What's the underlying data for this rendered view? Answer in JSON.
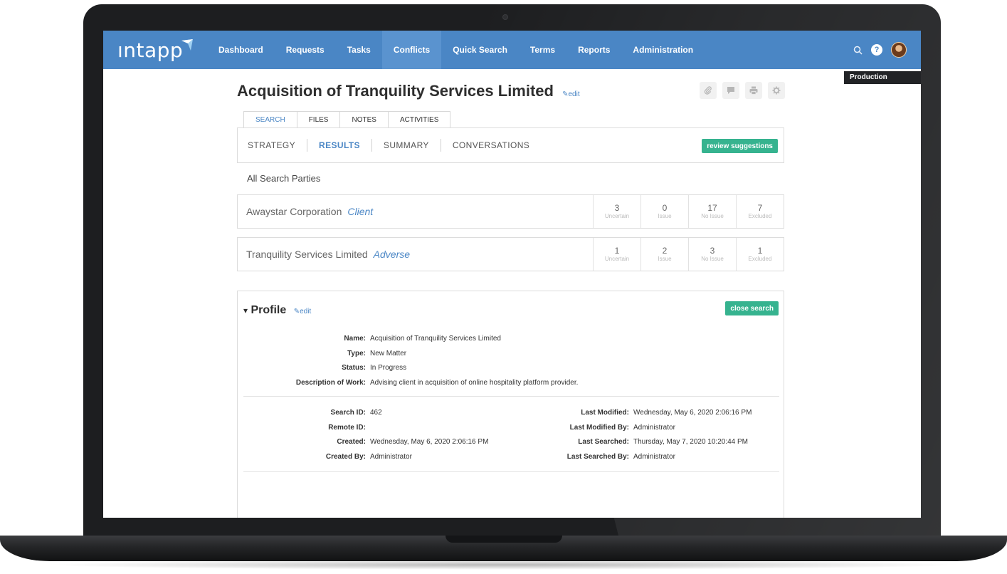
{
  "app": {
    "logo_text": "ıntapp",
    "environment": "Production"
  },
  "nav": {
    "items": [
      "Dashboard",
      "Requests",
      "Tasks",
      "Conflicts",
      "Quick Search",
      "Terms",
      "Reports",
      "Administration"
    ],
    "active": "Conflicts",
    "icons": [
      "search-icon",
      "help-icon",
      "avatar"
    ],
    "help_glyph": "?"
  },
  "matter": {
    "title": "Acquisition of Tranquility Services Limited",
    "edit_label": "edit"
  },
  "toolbar": {
    "icons": [
      "paperclip-icon",
      "comment-icon",
      "print-icon",
      "gear-icon"
    ]
  },
  "tabs": {
    "items": [
      "SEARCH",
      "FILES",
      "NOTES",
      "ACTIVITIES"
    ],
    "active": "SEARCH"
  },
  "subnav": {
    "items": [
      "STRATEGY",
      "RESULTS",
      "SUMMARY",
      "CONVERSATIONS"
    ],
    "active": "RESULTS",
    "review_button": "review suggestions"
  },
  "search_parties": {
    "heading": "All Search Parties",
    "parties": [
      {
        "name": "Awaystar Corporation",
        "role": "Client",
        "stats": [
          {
            "count": "3",
            "label": "Uncertain"
          },
          {
            "count": "0",
            "label": "Issue"
          },
          {
            "count": "17",
            "label": "No Issue"
          },
          {
            "count": "7",
            "label": "Excluded"
          }
        ]
      },
      {
        "name": "Tranquility Services Limited",
        "role": "Adverse",
        "stats": [
          {
            "count": "1",
            "label": "Uncertain"
          },
          {
            "count": "2",
            "label": "Issue"
          },
          {
            "count": "3",
            "label": "No Issue"
          },
          {
            "count": "1",
            "label": "Excluded"
          }
        ]
      }
    ]
  },
  "profile": {
    "title": "Profile",
    "toggle": "▾",
    "edit_label": "edit",
    "close_button": "close search",
    "name_key": "Name:",
    "name_val": "Acquisition of Tranquility Services Limited",
    "type_key": "Type:",
    "type_val": "New Matter",
    "status_key": "Status:",
    "status_val": "In Progress",
    "desc_key": "Description of Work:",
    "desc_val": "Advising client in acquisition of online hospitality platform provider.",
    "search_id_key": "Search ID:",
    "search_id_val": "462",
    "remote_id_key": "Remote ID:",
    "remote_id_val": "",
    "created_key": "Created:",
    "created_val": "Wednesday, May 6, 2020 2:06:16 PM",
    "created_by_key": "Created By:",
    "created_by_val": "Administrator",
    "last_modified_key": "Last Modified:",
    "last_modified_val": "Wednesday, May 6, 2020 2:06:16 PM",
    "last_modified_by_key": "Last Modified By:",
    "last_modified_by_val": "Administrator",
    "last_searched_key": "Last Searched:",
    "last_searched_val": "Thursday, May 7, 2020 10:20:44 PM",
    "last_searched_by_key": "Last Searched By:",
    "last_searched_by_val": "Administrator"
  },
  "colors": {
    "nav_blue": "#4a86c5",
    "accent_green": "#36b38f",
    "link_blue": "#4a86c5"
  }
}
